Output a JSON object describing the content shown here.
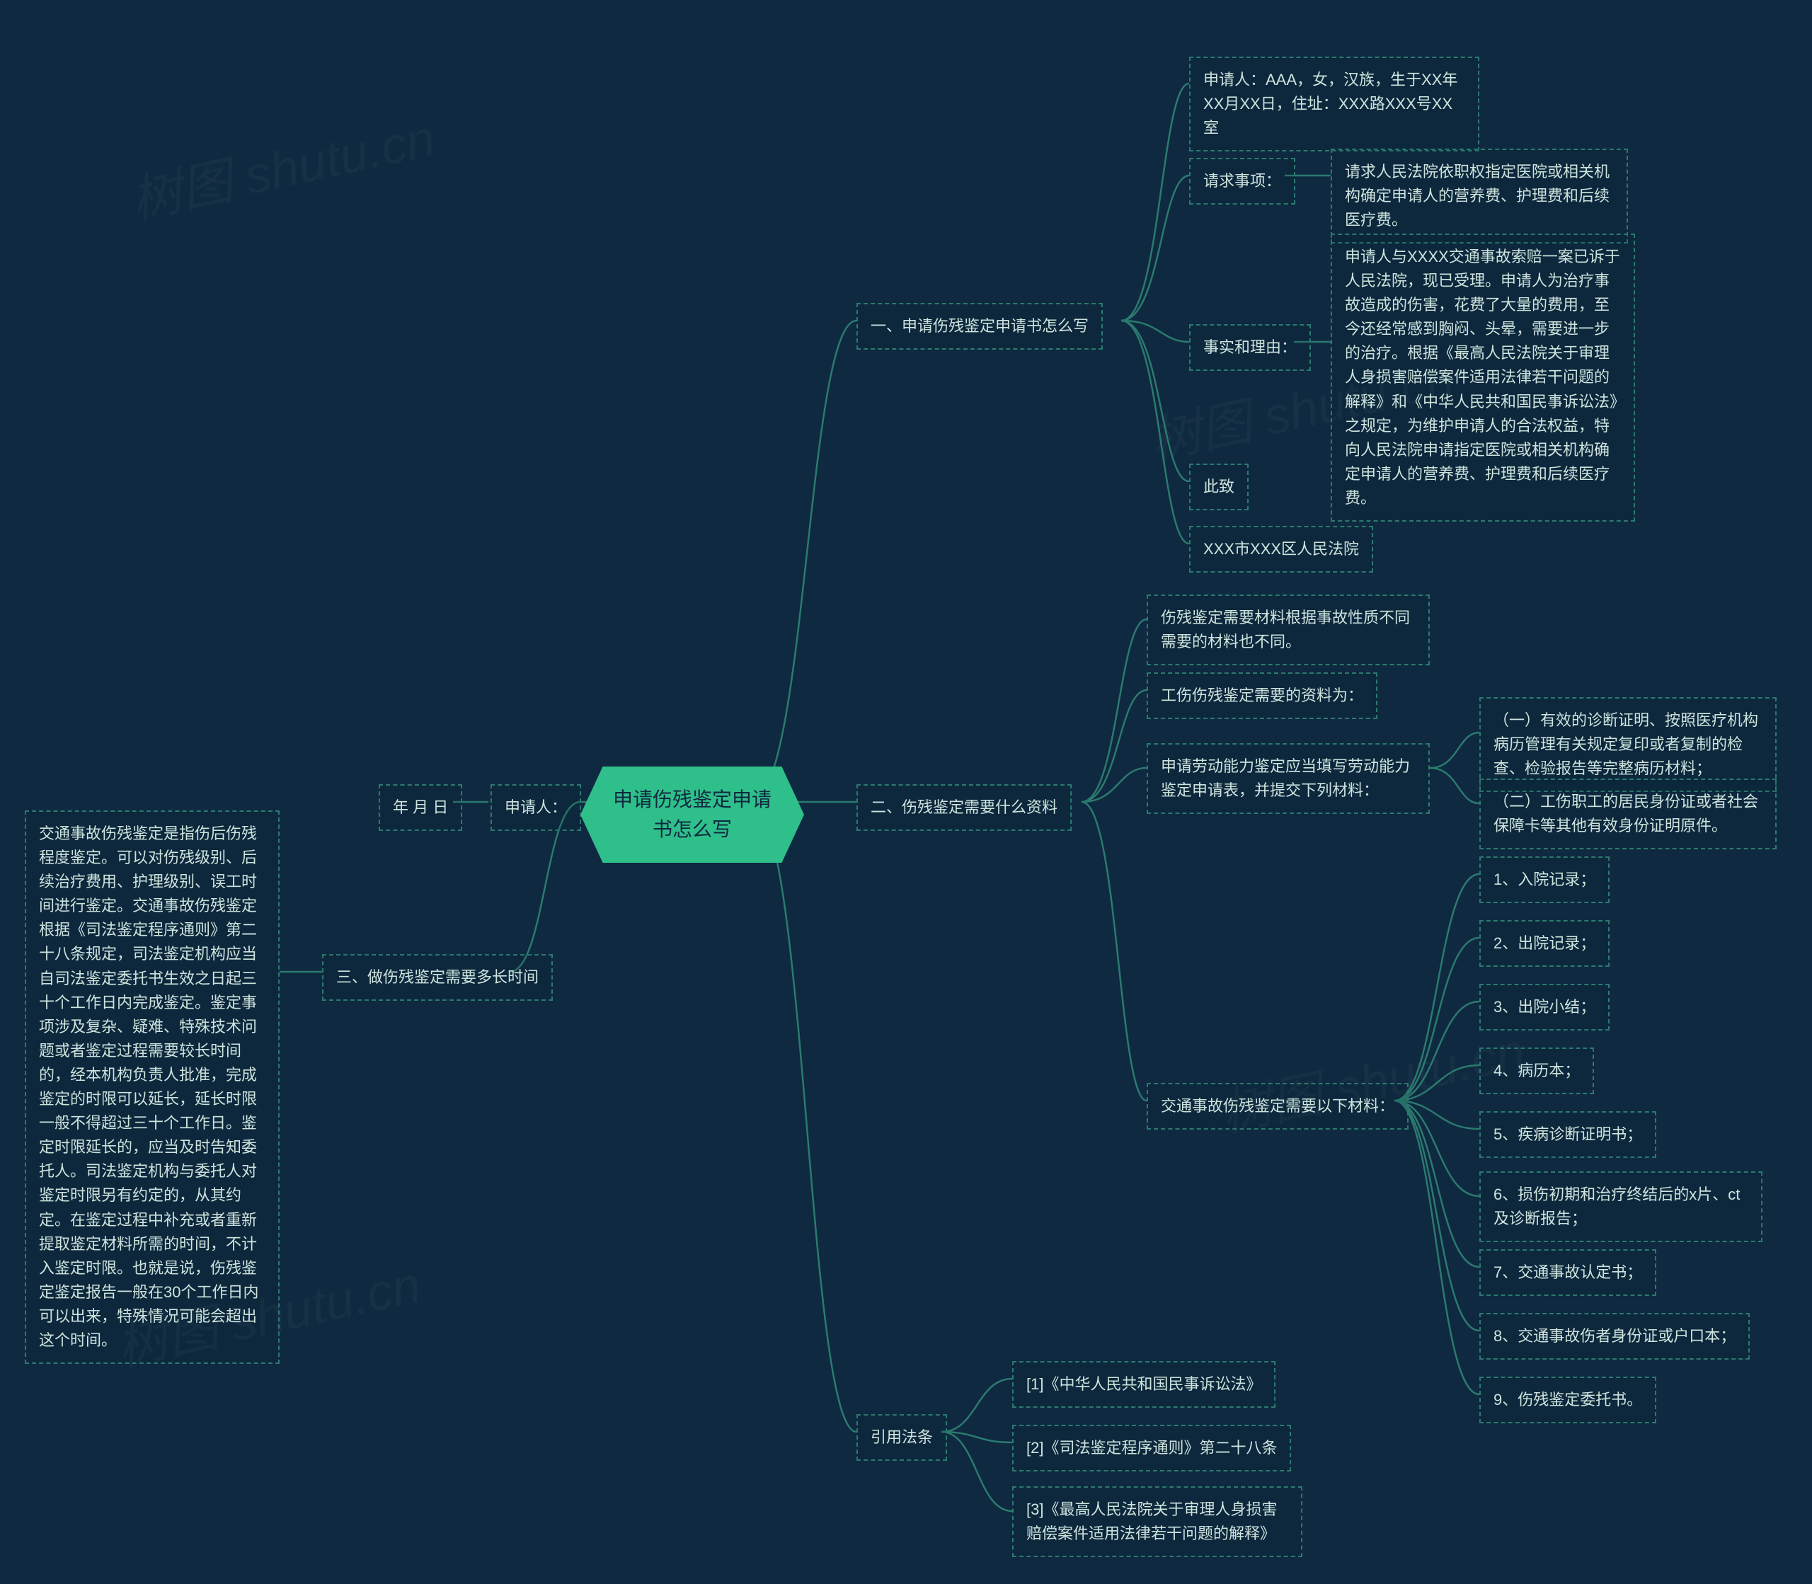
{
  "root": "申请伤残鉴定申请书怎么写",
  "watermark": "树图 shutu.cn",
  "branches": {
    "b1": {
      "title": "一、申请伤残鉴定申请书怎么写",
      "items": {
        "applicant": "申请人：AAA，女，汉族，生于XX年XX月XX日，住址：XXX路XXX号XX室",
        "request_label": "请求事项：",
        "request_text": "请求人民法院依职权指定医院或相关机构确定申请人的营养费、护理费和后续医疗费。",
        "facts_label": "事实和理由：",
        "facts_text": "申请人与XXXX交通事故索赔一案已诉于人民法院，现已受理。申请人为治疗事故造成的伤害，花费了大量的费用，至今还经常感到胸闷、头晕，需要进一步的治疗。根据《最高人民法院关于审理人身损害赔偿案件适用法律若干问题的解释》和《中华人民共和国民事诉讼法》之规定，为维护申请人的合法权益，特向人民法院申请指定医院或相关机构确定申请人的营养费、护理费和后续医疗费。",
        "closing": "此致",
        "court": "XXX市XXX区人民法院"
      }
    },
    "b2": {
      "title": "二、伤残鉴定需要什么资料",
      "items": {
        "intro": "伤残鉴定需要材料根据事故性质不同需要的材料也不同。",
        "work_injury_label": "工伤伤残鉴定需要的资料为：",
        "labor_cap": "申请劳动能力鉴定应当填写劳动能力鉴定申请表，并提交下列材料：",
        "labor_item1": "（一）有效的诊断证明、按照医疗机构病历管理有关规定复印或者复制的检查、检验报告等完整病历材料；",
        "labor_item2": "（二）工伤职工的居民身份证或者社会保障卡等其他有效身份证明原件。",
        "traffic_label": "交通事故伤残鉴定需要以下材料：",
        "t1": "1、入院记录；",
        "t2": "2、出院记录；",
        "t3": "3、出院小结；",
        "t4": "4、病历本；",
        "t5": "5、疾病诊断证明书；",
        "t6": "6、损伤初期和治疗终结后的x片、ct及诊断报告；",
        "t7": "7、交通事故认定书；",
        "t8": "8、交通事故伤者身份证或户口本；",
        "t9": "9、伤残鉴定委托书。"
      }
    },
    "b3": {
      "title": "三、做伤残鉴定需要多长时间",
      "detail": "交通事故伤残鉴定是指伤后伤残程度鉴定。可以对伤残级别、后续治疗费用、护理级别、误工时间进行鉴定。交通事故伤残鉴定根据《司法鉴定程序通则》第二十八条规定，司法鉴定机构应当自司法鉴定委托书生效之日起三十个工作日内完成鉴定。鉴定事项涉及复杂、疑难、特殊技术问题或者鉴定过程需要较长时间的，经本机构负责人批准，完成鉴定的时限可以延长，延长时限一般不得超过三十个工作日。鉴定时限延长的，应当及时告知委托人。司法鉴定机构与委托人对鉴定时限另有约定的，从其约定。在鉴定过程中补充或者重新提取鉴定材料所需的时间，不计入鉴定时限。也就是说，伤残鉴定鉴定报告一般在30个工作日内可以出来，特殊情况可能会超出这个时间。"
    },
    "b4": {
      "title": "引用法条",
      "items": {
        "c1": "[1]《中华人民共和国民事诉讼法》",
        "c2": "[2]《司法鉴定程序通则》第二十八条",
        "c3": "[3]《最高人民法院关于审理人身损害赔偿案件适用法律若干问题的解释》"
      }
    },
    "applicant_label": "申请人：",
    "date_label": "年 月 日"
  }
}
